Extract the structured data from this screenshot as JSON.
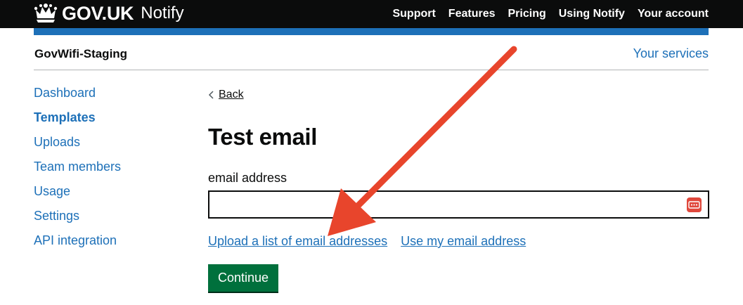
{
  "header": {
    "logo_text": "GOV.UK",
    "product": "Notify",
    "nav": [
      "Support",
      "Features",
      "Pricing",
      "Using Notify",
      "Your account"
    ]
  },
  "service": {
    "name": "GovWifi-Staging",
    "switch_label": "Your services"
  },
  "sidebar": {
    "items": [
      {
        "label": "Dashboard",
        "active": false
      },
      {
        "label": "Templates",
        "active": true
      },
      {
        "label": "Uploads",
        "active": false
      },
      {
        "label": "Team members",
        "active": false
      },
      {
        "label": "Usage",
        "active": false
      },
      {
        "label": "Settings",
        "active": false
      },
      {
        "label": "API integration",
        "active": false
      }
    ]
  },
  "main": {
    "back_label": "Back",
    "title": "Test email",
    "field_label": "email address",
    "field_value": "",
    "links": {
      "upload": "Upload a list of email addresses",
      "use_my": "Use my email address"
    },
    "continue_label": "Continue"
  },
  "icons": {
    "logo": "crown-icon",
    "back": "chevron-left-icon",
    "password_manager": "password-manager-icon",
    "annotation": "arrow-annotation-icon"
  },
  "colors": {
    "header_bg": "#0b0c0c",
    "brand_blue": "#1d70b8",
    "button_green": "#00703c",
    "annotation_red": "#e8452c"
  }
}
